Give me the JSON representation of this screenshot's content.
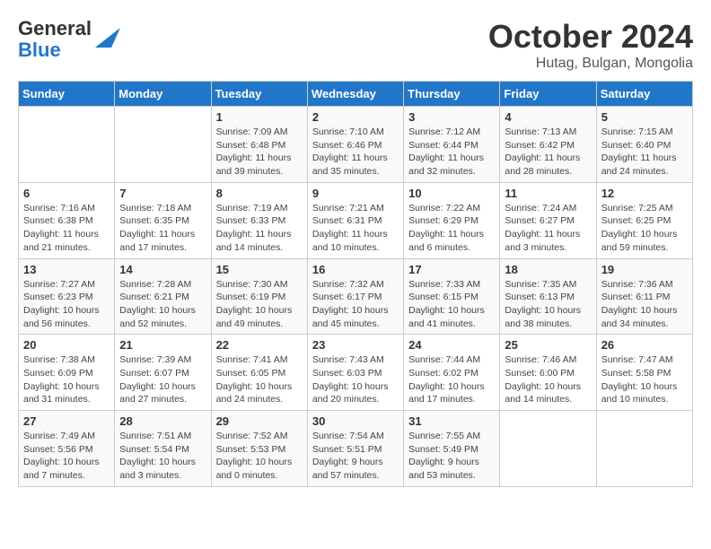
{
  "header": {
    "logo_line1": "General",
    "logo_line2": "Blue",
    "month_title": "October 2024",
    "location": "Hutag, Bulgan, Mongolia"
  },
  "days_of_week": [
    "Sunday",
    "Monday",
    "Tuesday",
    "Wednesday",
    "Thursday",
    "Friday",
    "Saturday"
  ],
  "weeks": [
    [
      {
        "day": "",
        "info": ""
      },
      {
        "day": "",
        "info": ""
      },
      {
        "day": "1",
        "info": "Sunrise: 7:09 AM\nSunset: 6:48 PM\nDaylight: 11 hours and 39 minutes."
      },
      {
        "day": "2",
        "info": "Sunrise: 7:10 AM\nSunset: 6:46 PM\nDaylight: 11 hours and 35 minutes."
      },
      {
        "day": "3",
        "info": "Sunrise: 7:12 AM\nSunset: 6:44 PM\nDaylight: 11 hours and 32 minutes."
      },
      {
        "day": "4",
        "info": "Sunrise: 7:13 AM\nSunset: 6:42 PM\nDaylight: 11 hours and 28 minutes."
      },
      {
        "day": "5",
        "info": "Sunrise: 7:15 AM\nSunset: 6:40 PM\nDaylight: 11 hours and 24 minutes."
      }
    ],
    [
      {
        "day": "6",
        "info": "Sunrise: 7:16 AM\nSunset: 6:38 PM\nDaylight: 11 hours and 21 minutes."
      },
      {
        "day": "7",
        "info": "Sunrise: 7:18 AM\nSunset: 6:35 PM\nDaylight: 11 hours and 17 minutes."
      },
      {
        "day": "8",
        "info": "Sunrise: 7:19 AM\nSunset: 6:33 PM\nDaylight: 11 hours and 14 minutes."
      },
      {
        "day": "9",
        "info": "Sunrise: 7:21 AM\nSunset: 6:31 PM\nDaylight: 11 hours and 10 minutes."
      },
      {
        "day": "10",
        "info": "Sunrise: 7:22 AM\nSunset: 6:29 PM\nDaylight: 11 hours and 6 minutes."
      },
      {
        "day": "11",
        "info": "Sunrise: 7:24 AM\nSunset: 6:27 PM\nDaylight: 11 hours and 3 minutes."
      },
      {
        "day": "12",
        "info": "Sunrise: 7:25 AM\nSunset: 6:25 PM\nDaylight: 10 hours and 59 minutes."
      }
    ],
    [
      {
        "day": "13",
        "info": "Sunrise: 7:27 AM\nSunset: 6:23 PM\nDaylight: 10 hours and 56 minutes."
      },
      {
        "day": "14",
        "info": "Sunrise: 7:28 AM\nSunset: 6:21 PM\nDaylight: 10 hours and 52 minutes."
      },
      {
        "day": "15",
        "info": "Sunrise: 7:30 AM\nSunset: 6:19 PM\nDaylight: 10 hours and 49 minutes."
      },
      {
        "day": "16",
        "info": "Sunrise: 7:32 AM\nSunset: 6:17 PM\nDaylight: 10 hours and 45 minutes."
      },
      {
        "day": "17",
        "info": "Sunrise: 7:33 AM\nSunset: 6:15 PM\nDaylight: 10 hours and 41 minutes."
      },
      {
        "day": "18",
        "info": "Sunrise: 7:35 AM\nSunset: 6:13 PM\nDaylight: 10 hours and 38 minutes."
      },
      {
        "day": "19",
        "info": "Sunrise: 7:36 AM\nSunset: 6:11 PM\nDaylight: 10 hours and 34 minutes."
      }
    ],
    [
      {
        "day": "20",
        "info": "Sunrise: 7:38 AM\nSunset: 6:09 PM\nDaylight: 10 hours and 31 minutes."
      },
      {
        "day": "21",
        "info": "Sunrise: 7:39 AM\nSunset: 6:07 PM\nDaylight: 10 hours and 27 minutes."
      },
      {
        "day": "22",
        "info": "Sunrise: 7:41 AM\nSunset: 6:05 PM\nDaylight: 10 hours and 24 minutes."
      },
      {
        "day": "23",
        "info": "Sunrise: 7:43 AM\nSunset: 6:03 PM\nDaylight: 10 hours and 20 minutes."
      },
      {
        "day": "24",
        "info": "Sunrise: 7:44 AM\nSunset: 6:02 PM\nDaylight: 10 hours and 17 minutes."
      },
      {
        "day": "25",
        "info": "Sunrise: 7:46 AM\nSunset: 6:00 PM\nDaylight: 10 hours and 14 minutes."
      },
      {
        "day": "26",
        "info": "Sunrise: 7:47 AM\nSunset: 5:58 PM\nDaylight: 10 hours and 10 minutes."
      }
    ],
    [
      {
        "day": "27",
        "info": "Sunrise: 7:49 AM\nSunset: 5:56 PM\nDaylight: 10 hours and 7 minutes."
      },
      {
        "day": "28",
        "info": "Sunrise: 7:51 AM\nSunset: 5:54 PM\nDaylight: 10 hours and 3 minutes."
      },
      {
        "day": "29",
        "info": "Sunrise: 7:52 AM\nSunset: 5:53 PM\nDaylight: 10 hours and 0 minutes."
      },
      {
        "day": "30",
        "info": "Sunrise: 7:54 AM\nSunset: 5:51 PM\nDaylight: 9 hours and 57 minutes."
      },
      {
        "day": "31",
        "info": "Sunrise: 7:55 AM\nSunset: 5:49 PM\nDaylight: 9 hours and 53 minutes."
      },
      {
        "day": "",
        "info": ""
      },
      {
        "day": "",
        "info": ""
      }
    ]
  ]
}
